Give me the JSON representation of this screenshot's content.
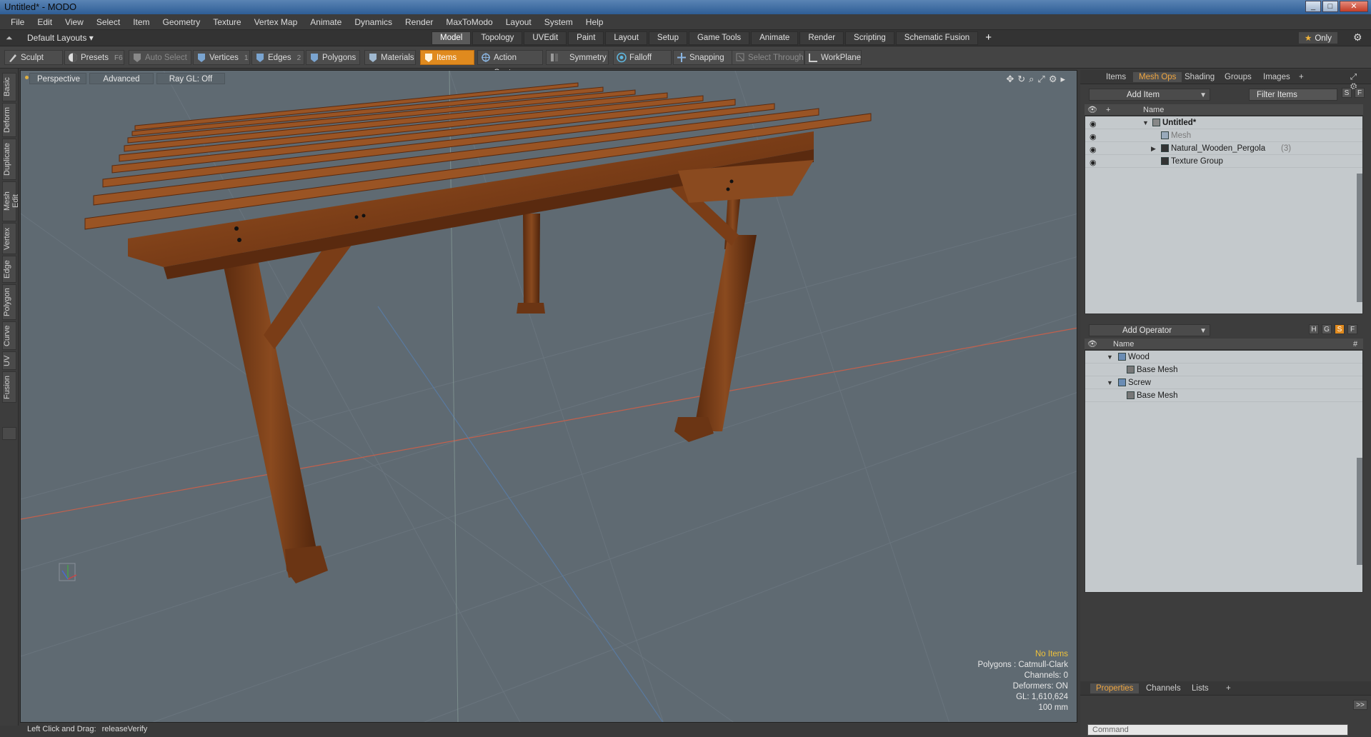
{
  "window": {
    "title": "Untitled* - MODO",
    "controls": [
      "_",
      "□",
      "✕"
    ]
  },
  "menu": [
    "File",
    "Edit",
    "View",
    "Select",
    "Item",
    "Geometry",
    "Texture",
    "Vertex Map",
    "Animate",
    "Dynamics",
    "Render",
    "MaxToModo",
    "Layout",
    "System",
    "Help"
  ],
  "layoutbar": {
    "layout_name": "Default Layouts ▾",
    "tabs": [
      "Model",
      "Topology",
      "UVEdit",
      "Paint",
      "Layout",
      "Setup",
      "Game Tools",
      "Animate",
      "Render",
      "Scripting",
      "Schematic Fusion"
    ],
    "active_tab": "Model",
    "plus": "+",
    "only_label": "Only",
    "star": "★"
  },
  "toolbar": {
    "sculpt": "Sculpt",
    "presets": "Presets",
    "presets_key": "F6",
    "auto_select": "Auto Select",
    "vertices": "Vertices",
    "vertices_key": "1",
    "edges": "Edges",
    "edges_key": "2",
    "polygons": "Polygons",
    "materials": "Materials",
    "items": "Items",
    "action_center": "Action Center",
    "symmetry": "Symmetry",
    "falloff": "Falloff",
    "snapping": "Snapping",
    "select_through": "Select Through",
    "workplane": "WorkPlane"
  },
  "left_tabs": [
    "Basic",
    "Deform",
    "Duplicate",
    "Mesh Edit",
    "Vertex",
    "Edge",
    "Polygon",
    "Curve",
    "UV",
    "Fusion"
  ],
  "viewport": {
    "perspective": "Perspective",
    "advanced": "Advanced",
    "raygl": "Ray GL: Off",
    "info": {
      "no_items": "No Items",
      "polygons": "Polygons : Catmull-Clark",
      "channels": "Channels: 0",
      "deformers": "Deformers: ON",
      "gl": "GL: 1,610,624",
      "scale": "100 mm"
    }
  },
  "status": {
    "label": "Left Click and Drag:",
    "value": "releaseVerify"
  },
  "items_panel": {
    "tabs": [
      "Items",
      "Mesh Ops",
      "Shading",
      "Groups",
      "Images",
      "+"
    ],
    "active_tab": "Mesh Ops",
    "add_item": "Add Item",
    "filter": "Filter Items",
    "s": "S",
    "f": "F",
    "col_name": "Name",
    "rows": [
      {
        "label": "Untitled*",
        "count": ""
      },
      {
        "label": "Mesh",
        "count": ""
      },
      {
        "label": "Natural_Wooden_Pergola",
        "count": "(3)"
      },
      {
        "label": "Texture Group",
        "count": ""
      }
    ]
  },
  "ops_panel": {
    "add_operator": "Add Operator",
    "h": "H",
    "g": "G",
    "s": "S",
    "f": "F",
    "col_name": "Name",
    "col_hash": "#",
    "rows": [
      {
        "label": "Wood"
      },
      {
        "label": "Base Mesh"
      },
      {
        "label": "Screw"
      },
      {
        "label": "Base Mesh"
      }
    ]
  },
  "props_panel": {
    "tabs": [
      "Properties",
      "Channels",
      "Lists",
      "+"
    ],
    "active_tab": "Properties",
    "expand": ">>"
  },
  "command": {
    "placeholder": "Command"
  },
  "colors": {
    "accent": "#e08a1e",
    "viewport_bg": "#5f6a72",
    "wood": "#8a4a1f"
  }
}
